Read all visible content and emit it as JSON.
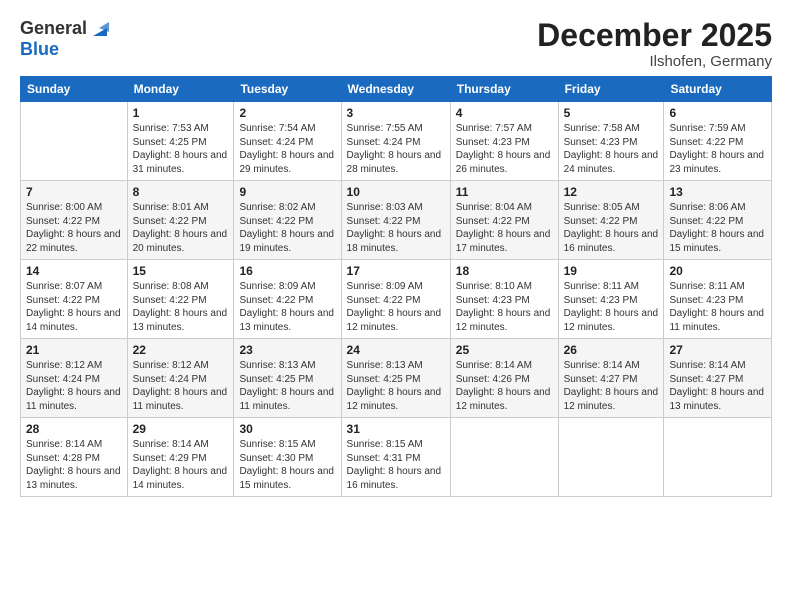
{
  "header": {
    "logo_line1": "General",
    "logo_line2": "Blue",
    "month": "December 2025",
    "location": "Ilshofen, Germany"
  },
  "weekdays": [
    "Sunday",
    "Monday",
    "Tuesday",
    "Wednesday",
    "Thursday",
    "Friday",
    "Saturday"
  ],
  "weeks": [
    [
      {
        "day": "",
        "sunrise": "",
        "sunset": "",
        "daylight": ""
      },
      {
        "day": "1",
        "sunrise": "Sunrise: 7:53 AM",
        "sunset": "Sunset: 4:25 PM",
        "daylight": "Daylight: 8 hours and 31 minutes."
      },
      {
        "day": "2",
        "sunrise": "Sunrise: 7:54 AM",
        "sunset": "Sunset: 4:24 PM",
        "daylight": "Daylight: 8 hours and 29 minutes."
      },
      {
        "day": "3",
        "sunrise": "Sunrise: 7:55 AM",
        "sunset": "Sunset: 4:24 PM",
        "daylight": "Daylight: 8 hours and 28 minutes."
      },
      {
        "day": "4",
        "sunrise": "Sunrise: 7:57 AM",
        "sunset": "Sunset: 4:23 PM",
        "daylight": "Daylight: 8 hours and 26 minutes."
      },
      {
        "day": "5",
        "sunrise": "Sunrise: 7:58 AM",
        "sunset": "Sunset: 4:23 PM",
        "daylight": "Daylight: 8 hours and 24 minutes."
      },
      {
        "day": "6",
        "sunrise": "Sunrise: 7:59 AM",
        "sunset": "Sunset: 4:22 PM",
        "daylight": "Daylight: 8 hours and 23 minutes."
      }
    ],
    [
      {
        "day": "7",
        "sunrise": "Sunrise: 8:00 AM",
        "sunset": "Sunset: 4:22 PM",
        "daylight": "Daylight: 8 hours and 22 minutes."
      },
      {
        "day": "8",
        "sunrise": "Sunrise: 8:01 AM",
        "sunset": "Sunset: 4:22 PM",
        "daylight": "Daylight: 8 hours and 20 minutes."
      },
      {
        "day": "9",
        "sunrise": "Sunrise: 8:02 AM",
        "sunset": "Sunset: 4:22 PM",
        "daylight": "Daylight: 8 hours and 19 minutes."
      },
      {
        "day": "10",
        "sunrise": "Sunrise: 8:03 AM",
        "sunset": "Sunset: 4:22 PM",
        "daylight": "Daylight: 8 hours and 18 minutes."
      },
      {
        "day": "11",
        "sunrise": "Sunrise: 8:04 AM",
        "sunset": "Sunset: 4:22 PM",
        "daylight": "Daylight: 8 hours and 17 minutes."
      },
      {
        "day": "12",
        "sunrise": "Sunrise: 8:05 AM",
        "sunset": "Sunset: 4:22 PM",
        "daylight": "Daylight: 8 hours and 16 minutes."
      },
      {
        "day": "13",
        "sunrise": "Sunrise: 8:06 AM",
        "sunset": "Sunset: 4:22 PM",
        "daylight": "Daylight: 8 hours and 15 minutes."
      }
    ],
    [
      {
        "day": "14",
        "sunrise": "Sunrise: 8:07 AM",
        "sunset": "Sunset: 4:22 PM",
        "daylight": "Daylight: 8 hours and 14 minutes."
      },
      {
        "day": "15",
        "sunrise": "Sunrise: 8:08 AM",
        "sunset": "Sunset: 4:22 PM",
        "daylight": "Daylight: 8 hours and 13 minutes."
      },
      {
        "day": "16",
        "sunrise": "Sunrise: 8:09 AM",
        "sunset": "Sunset: 4:22 PM",
        "daylight": "Daylight: 8 hours and 13 minutes."
      },
      {
        "day": "17",
        "sunrise": "Sunrise: 8:09 AM",
        "sunset": "Sunset: 4:22 PM",
        "daylight": "Daylight: 8 hours and 12 minutes."
      },
      {
        "day": "18",
        "sunrise": "Sunrise: 8:10 AM",
        "sunset": "Sunset: 4:23 PM",
        "daylight": "Daylight: 8 hours and 12 minutes."
      },
      {
        "day": "19",
        "sunrise": "Sunrise: 8:11 AM",
        "sunset": "Sunset: 4:23 PM",
        "daylight": "Daylight: 8 hours and 12 minutes."
      },
      {
        "day": "20",
        "sunrise": "Sunrise: 8:11 AM",
        "sunset": "Sunset: 4:23 PM",
        "daylight": "Daylight: 8 hours and 11 minutes."
      }
    ],
    [
      {
        "day": "21",
        "sunrise": "Sunrise: 8:12 AM",
        "sunset": "Sunset: 4:24 PM",
        "daylight": "Daylight: 8 hours and 11 minutes."
      },
      {
        "day": "22",
        "sunrise": "Sunrise: 8:12 AM",
        "sunset": "Sunset: 4:24 PM",
        "daylight": "Daylight: 8 hours and 11 minutes."
      },
      {
        "day": "23",
        "sunrise": "Sunrise: 8:13 AM",
        "sunset": "Sunset: 4:25 PM",
        "daylight": "Daylight: 8 hours and 11 minutes."
      },
      {
        "day": "24",
        "sunrise": "Sunrise: 8:13 AM",
        "sunset": "Sunset: 4:25 PM",
        "daylight": "Daylight: 8 hours and 12 minutes."
      },
      {
        "day": "25",
        "sunrise": "Sunrise: 8:14 AM",
        "sunset": "Sunset: 4:26 PM",
        "daylight": "Daylight: 8 hours and 12 minutes."
      },
      {
        "day": "26",
        "sunrise": "Sunrise: 8:14 AM",
        "sunset": "Sunset: 4:27 PM",
        "daylight": "Daylight: 8 hours and 12 minutes."
      },
      {
        "day": "27",
        "sunrise": "Sunrise: 8:14 AM",
        "sunset": "Sunset: 4:27 PM",
        "daylight": "Daylight: 8 hours and 13 minutes."
      }
    ],
    [
      {
        "day": "28",
        "sunrise": "Sunrise: 8:14 AM",
        "sunset": "Sunset: 4:28 PM",
        "daylight": "Daylight: 8 hours and 13 minutes."
      },
      {
        "day": "29",
        "sunrise": "Sunrise: 8:14 AM",
        "sunset": "Sunset: 4:29 PM",
        "daylight": "Daylight: 8 hours and 14 minutes."
      },
      {
        "day": "30",
        "sunrise": "Sunrise: 8:15 AM",
        "sunset": "Sunset: 4:30 PM",
        "daylight": "Daylight: 8 hours and 15 minutes."
      },
      {
        "day": "31",
        "sunrise": "Sunrise: 8:15 AM",
        "sunset": "Sunset: 4:31 PM",
        "daylight": "Daylight: 8 hours and 16 minutes."
      },
      {
        "day": "",
        "sunrise": "",
        "sunset": "",
        "daylight": ""
      },
      {
        "day": "",
        "sunrise": "",
        "sunset": "",
        "daylight": ""
      },
      {
        "day": "",
        "sunrise": "",
        "sunset": "",
        "daylight": ""
      }
    ]
  ]
}
